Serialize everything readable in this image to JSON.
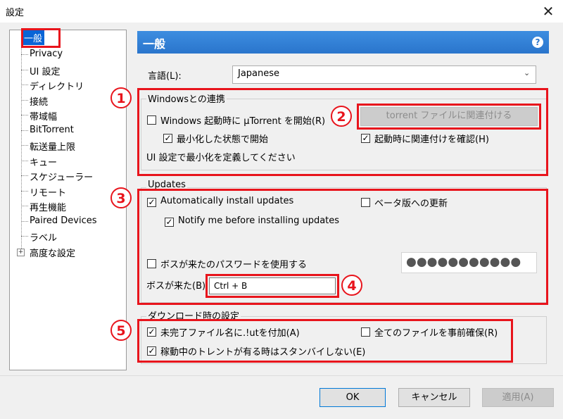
{
  "window": {
    "title": "設定",
    "close_glyph": "✕"
  },
  "sidebar": {
    "items": [
      {
        "label": "一般",
        "selected": true
      },
      {
        "label": "Privacy"
      },
      {
        "label": "UI 設定"
      },
      {
        "label": "ディレクトリ"
      },
      {
        "label": "接続"
      },
      {
        "label": "帯域幅"
      },
      {
        "label": "BitTorrent"
      },
      {
        "label": "転送量上限"
      },
      {
        "label": "キュー"
      },
      {
        "label": "スケジューラー"
      },
      {
        "label": "リモート"
      },
      {
        "label": "再生機能"
      },
      {
        "label": "Paired Devices"
      },
      {
        "label": "ラベル"
      },
      {
        "label": "高度な設定",
        "expandable": true,
        "expander_glyph": "+"
      }
    ]
  },
  "header": {
    "title": "一般",
    "help_glyph": "?"
  },
  "language": {
    "label": "言語(L):",
    "value": "Japanese",
    "chevron_icon": "chevron-down-icon"
  },
  "windows_group": {
    "title": "Windowsとの連携",
    "start_on_boot": {
      "label": "Windows 起動時に µTorrent を開始(R)",
      "checked": false
    },
    "start_minimized": {
      "label": "最小化した状態で開始",
      "checked": true
    },
    "minimize_note": "UI 設定で最小化を定義してください",
    "associate_button": "torrent ファイルに関連付ける",
    "check_assoc": {
      "label": "起動時に関連付けを確認(H)",
      "checked": true
    }
  },
  "updates_group": {
    "title": "Updates",
    "auto_install": {
      "label": "Automatically install updates",
      "checked": true
    },
    "beta": {
      "label": "ベータ版への更新",
      "checked": false
    },
    "notify": {
      "label": "Notify me before installing updates",
      "checked": true
    },
    "boss_password": {
      "label": "ボスが来たのパスワードを使用する",
      "checked": false
    },
    "password_mask": "●●●●●●●●●●●",
    "boss_key_label": "ボスが来た(B):",
    "boss_key_value": "Ctrl + B"
  },
  "download_group": {
    "title": "ダウンロード時の設定",
    "append_ut": {
      "label": "未完了ファイル名に.!utを付加(A)",
      "checked": true
    },
    "prealloc": {
      "label": "全てのファイルを事前確保(R)",
      "checked": false
    },
    "no_standby": {
      "label": "稼動中のトレントが有る時はスタンバイしない(E)",
      "checked": true
    }
  },
  "annotations": [
    "1",
    "2",
    "3",
    "4",
    "5"
  ],
  "footer": {
    "ok": "OK",
    "cancel": "キャンセル",
    "apply": "適用(A)"
  },
  "colors": {
    "accent_header": "#2a75cc",
    "selection": "#0a64d6",
    "annotation_red": "#e8141c"
  }
}
